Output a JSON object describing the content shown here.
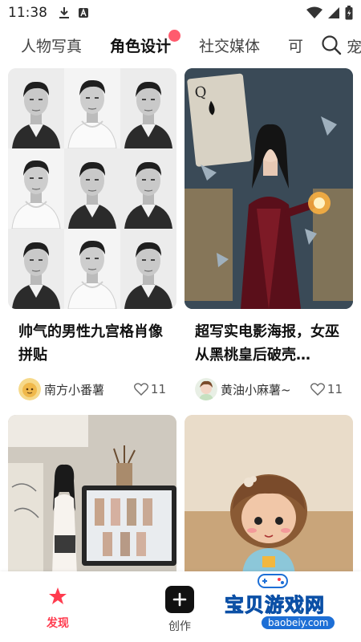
{
  "status_bar": {
    "time": "11:38"
  },
  "tabs": [
    {
      "label": "人物写真"
    },
    {
      "label": "角色设计"
    },
    {
      "label": "社交媒体"
    },
    {
      "label": "可"
    }
  ],
  "tab_more": "宠",
  "cards": [
    {
      "title": "帅气的男性九宫格肖像拼贴",
      "author": "南方小番薯",
      "likes": "11"
    },
    {
      "title": "超写实电影海报，女巫从黑桃皇后破壳…",
      "author": "黄油小麻薯~",
      "likes": "11"
    }
  ],
  "nav": {
    "discover": "发现",
    "create": "创作"
  },
  "watermark": {
    "text": "宝贝游戏网",
    "url": "baobeiy.com"
  },
  "colors": {
    "accent": "#ff3b4e",
    "badge": "#ff5b6e"
  }
}
